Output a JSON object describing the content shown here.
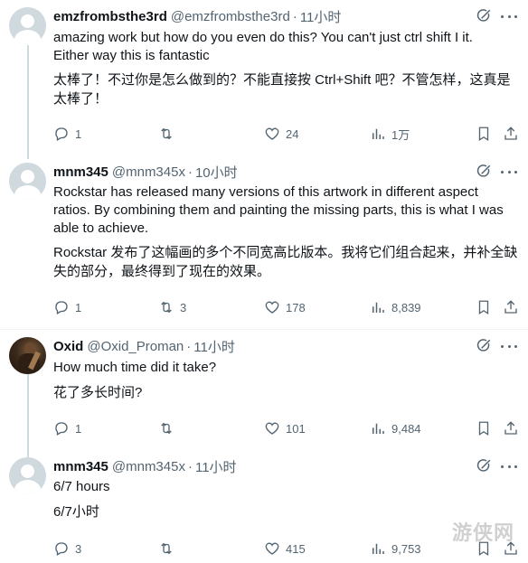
{
  "tweets": [
    {
      "name": "emzfrombsthe3rd",
      "handle": "@emzfrombsthe3rd",
      "dot": "·",
      "time": "11小时",
      "text_line1": "amazing work but how do you even do this? You can't just ctrl shift I it.",
      "text_line2": "Either way this is fantastic",
      "translation_line1": "太棒了！不过你是怎么做到的？不能直接按 Ctrl+Shift 吧？不管怎样，这真是",
      "translation_line2": "太棒了！",
      "replies": "1",
      "retweets": "",
      "likes": "24",
      "views": "1万"
    },
    {
      "name": "mnm345",
      "handle": "@mnm345x",
      "dot": "·",
      "time": "10小时",
      "text_line1": "Rockstar has released many versions of this artwork in different aspect",
      "text_line2": "ratios. By combining them and painting the missing parts, this is what I was",
      "text_line3": "able to achieve.",
      "translation_line1": "Rockstar 发布了这幅画的多个不同宽高比版本。我将它们组合起来，并补全缺",
      "translation_line2": "失的部分，最终得到了现在的效果。",
      "replies": "1",
      "retweets": "3",
      "likes": "178",
      "views": "8,839"
    },
    {
      "name": "Oxid",
      "handle": "@Oxid_Proman",
      "dot": "·",
      "time": "11小时",
      "text_line1": "How much time did it take?",
      "translation_line1": "花了多长时间?",
      "replies": "1",
      "retweets": "",
      "likes": "101",
      "views": "9,484"
    },
    {
      "name": "mnm345",
      "handle": "@mnm345x",
      "dot": "·",
      "time": "11小时",
      "text_line1": "6/7 hours",
      "translation_line1": "6/7小时",
      "replies": "3",
      "retweets": "",
      "likes": "415",
      "views": "9,753"
    }
  ],
  "watermark": "游侠网",
  "icons": [
    "grok-icon",
    "more-icon",
    "reply-icon",
    "retweet-icon",
    "like-icon",
    "views-icon",
    "bookmark-icon",
    "share-icon",
    "default-avatar-icon"
  ],
  "colors": {
    "text": "#0f1419",
    "secondary": "#536471",
    "divider": "#eff3f4",
    "thread_line": "#cfd9de"
  }
}
